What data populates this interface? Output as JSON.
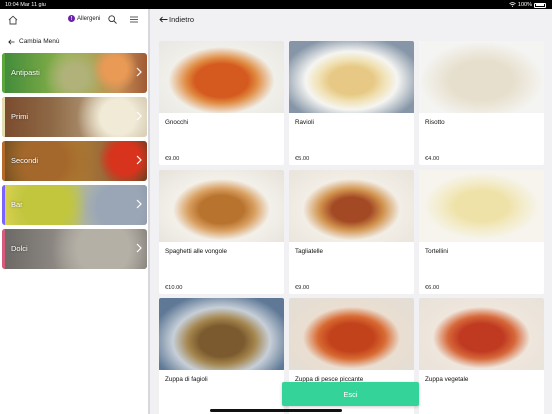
{
  "status_bar": {
    "time_date": "10:04  Mar 11 giu",
    "battery": "100%"
  },
  "sidebar": {
    "allergens_label": "Allergeni",
    "allergens_badge": "!",
    "change_menu_label": "Cambia Menù",
    "categories": [
      {
        "label": "Antipasti",
        "accent": "#6fbf4a"
      },
      {
        "label": "Primi",
        "accent": "#e7e0b7"
      },
      {
        "label": "Secondi",
        "accent": "#b96a2c"
      },
      {
        "label": "Bar",
        "accent": "#7e66ff"
      },
      {
        "label": "Dolci",
        "accent": "#d65a7a"
      }
    ]
  },
  "main": {
    "back_label": "Indietro",
    "items": [
      {
        "name": "Gnocchi",
        "price": "€9.00"
      },
      {
        "name": "Ravioli",
        "price": "€5.00"
      },
      {
        "name": "Risotto",
        "price": "€4.00"
      },
      {
        "name": "Spaghetti alle vongole",
        "price": "€10.00"
      },
      {
        "name": "Tagliatelle",
        "price": "€9.00"
      },
      {
        "name": "Tortellini",
        "price": "€6.00"
      },
      {
        "name": "Zuppa di fagioli",
        "price": ""
      },
      {
        "name": "Zuppa di pesce piccante",
        "price": ""
      },
      {
        "name": "Zuppa vegetale",
        "price": ""
      }
    ],
    "exit_label": "Esci"
  },
  "colors": {
    "accent_purple": "#6b21a8",
    "exit_green": "#34d399"
  }
}
